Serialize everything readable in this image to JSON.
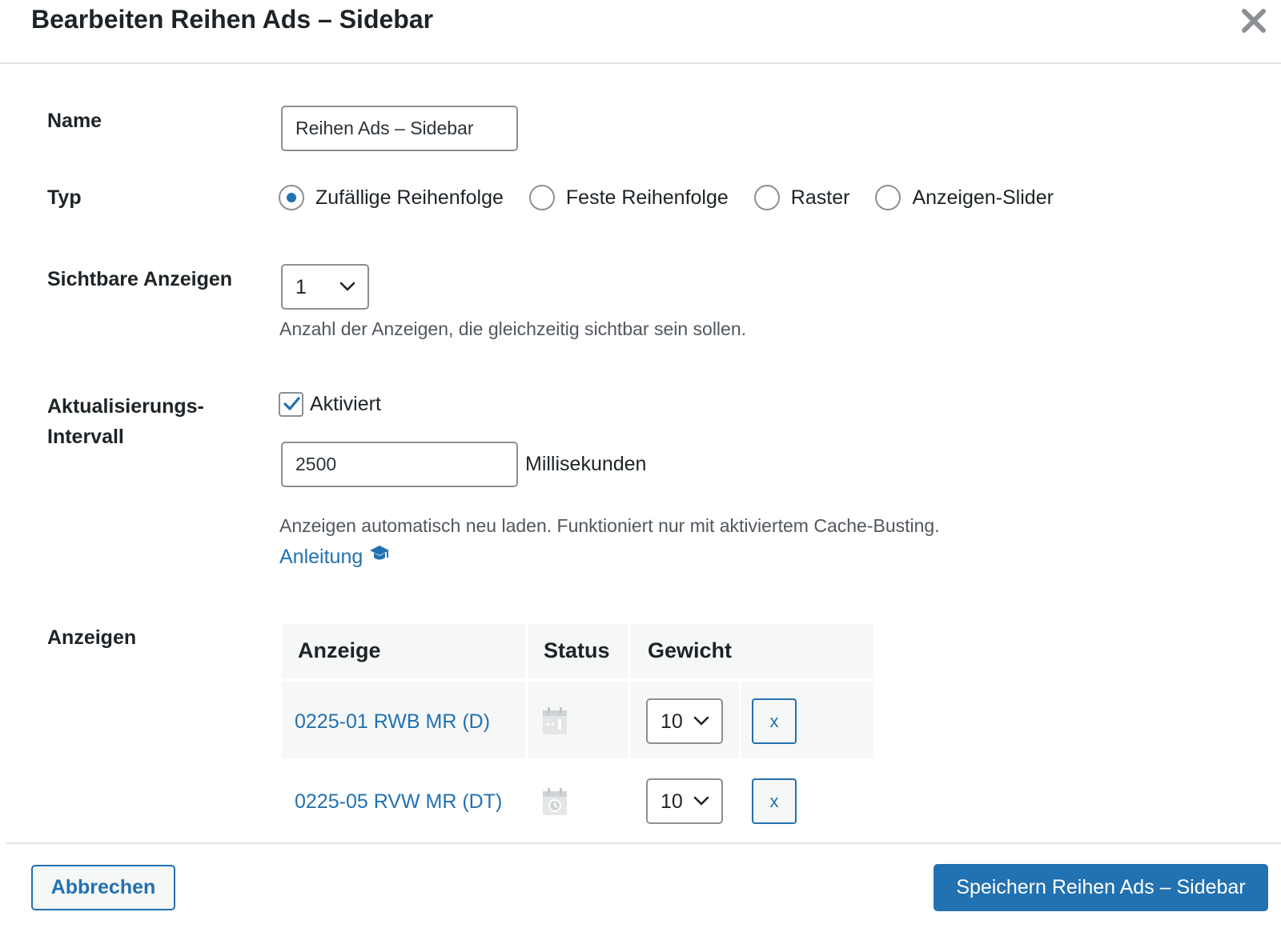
{
  "dialog": {
    "title": "Bearbeiten Reihen Ads – Sidebar",
    "close_icon": "close-icon"
  },
  "fields": {
    "name": {
      "label": "Name",
      "value": "Reihen Ads – Sidebar"
    },
    "type": {
      "label": "Typ",
      "options": [
        "Zufällige Reihenfolge",
        "Feste Reihenfolge",
        "Raster",
        "Anzeigen-Slider"
      ],
      "selected": "Zufällige Reihenfolge"
    },
    "visible_ads": {
      "label": "Sichtbare Anzeigen",
      "value": "1",
      "description": "Anzahl der Anzeigen, die gleichzeitig sichtbar sein sollen."
    },
    "refresh_interval": {
      "label_line1": "Aktualisierungs-",
      "label_line2": "Intervall",
      "checkbox_label": "Aktiviert",
      "checked": true,
      "value": "2500",
      "unit": "Millisekunden",
      "description": "Anzeigen automatisch neu laden. Funktioniert nur mit aktiviertem Cache-Busting.",
      "link": "Anleitung",
      "link_icon": "graduation-cap-icon"
    },
    "ads": {
      "label": "Anzeigen",
      "columns": [
        "Anzeige",
        "Status",
        "Gewicht"
      ],
      "rows": [
        {
          "name": "0225-01 RWB MR (D)",
          "status_icon": "calendar-icon",
          "weight": "10",
          "remove": "x"
        },
        {
          "name": "0225-05 RVW MR (DT)",
          "status_icon": "calendar-clock-icon",
          "weight": "10",
          "remove": "x"
        }
      ]
    }
  },
  "footer": {
    "cancel": "Abbrechen",
    "save": "Speichern Reihen Ads – Sidebar"
  },
  "colors": {
    "accent": "#2271b1",
    "text": "#1d2327",
    "muted": "#50575e",
    "border": "#8c8f94",
    "table_bg": "#f6f7f7"
  }
}
